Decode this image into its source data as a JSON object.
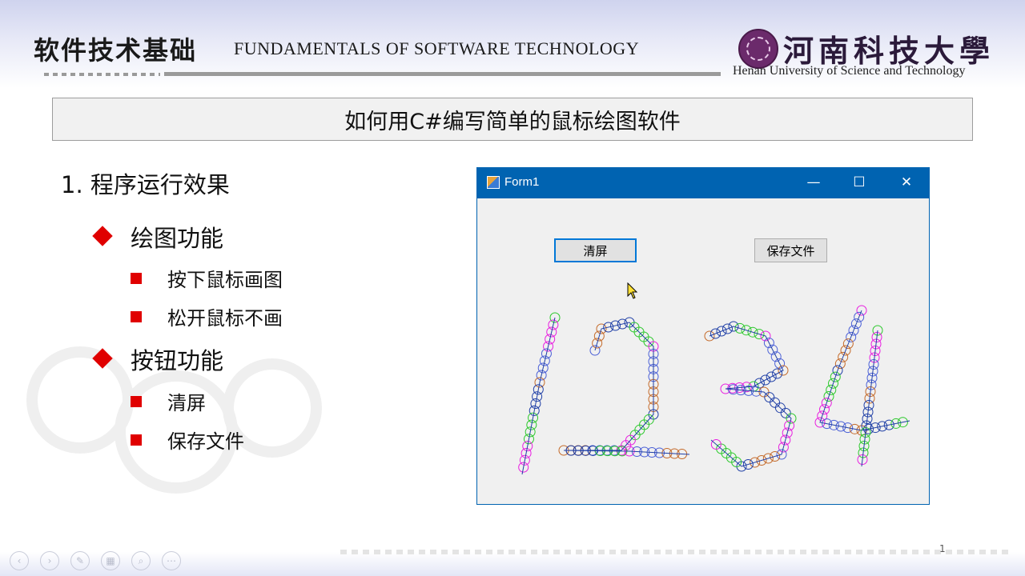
{
  "header": {
    "course_cn": "软件技术基础",
    "course_en": "FUNDAMENTALS OF SOFTWARE TECHNOLOGY",
    "university_cn": "河南科技大學",
    "university_en": "Henan University of Science and Technology"
  },
  "slide": {
    "title": "如何用C#编写简单的鼠标绘图软件",
    "point": "1. 程序运行效果",
    "sections": [
      {
        "label": "绘图功能",
        "items": [
          "按下鼠标画图",
          "松开鼠标不画"
        ]
      },
      {
        "label": "按钮功能",
        "items": [
          "清屏",
          "保存文件"
        ]
      }
    ]
  },
  "form_window": {
    "title": "Form1",
    "minimize_glyph": "—",
    "maximize_glyph": "☐",
    "close_glyph": "✕",
    "clear_button": "清屏",
    "save_button": "保存文件",
    "stroke_colors": [
      "#2cc82c",
      "#e81fe0",
      "#4a5fd6",
      "#c46a2a",
      "#1f3fa6"
    ]
  },
  "footer": {
    "page_number": "1",
    "nav_icons": [
      "prev-icon",
      "next-icon",
      "pen-icon",
      "slides-icon",
      "zoom-icon",
      "more-icon"
    ],
    "nav_glyphs": [
      "‹",
      "›",
      "✎",
      "▦",
      "⌕",
      "⋯"
    ]
  }
}
